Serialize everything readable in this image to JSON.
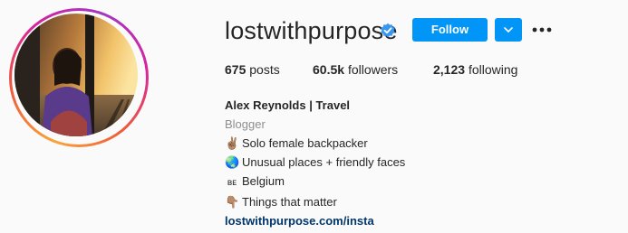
{
  "profile": {
    "username": "lostwithpurpose",
    "follow_label": "Follow",
    "stats": {
      "posts_count": "675",
      "posts_label": "posts",
      "followers_count": "60.5k",
      "followers_label": "followers",
      "following_count": "2,123",
      "following_label": "following"
    },
    "bio": {
      "name": "Alex Reynolds | Travel",
      "category": "Blogger",
      "lines": [
        {
          "emoji": "✌🏽",
          "text": "Solo female backpacker"
        },
        {
          "emoji": "🌏",
          "text": "Unusual places + friendly faces"
        },
        {
          "emoji": "ʙᴇ",
          "text": "Belgium"
        },
        {
          "emoji": "👇🏽",
          "text": "Things that matter"
        }
      ],
      "link": "lostwithpurpose.com/insta"
    }
  },
  "colors": {
    "primary_button": "#0095f6",
    "verified_badge": "#3897f0",
    "link": "#00376b",
    "muted": "#8e8e8e"
  },
  "icons": {
    "verified": "verified-badge-icon",
    "dropdown": "chevron-down-icon",
    "more": "more-options-icon"
  }
}
